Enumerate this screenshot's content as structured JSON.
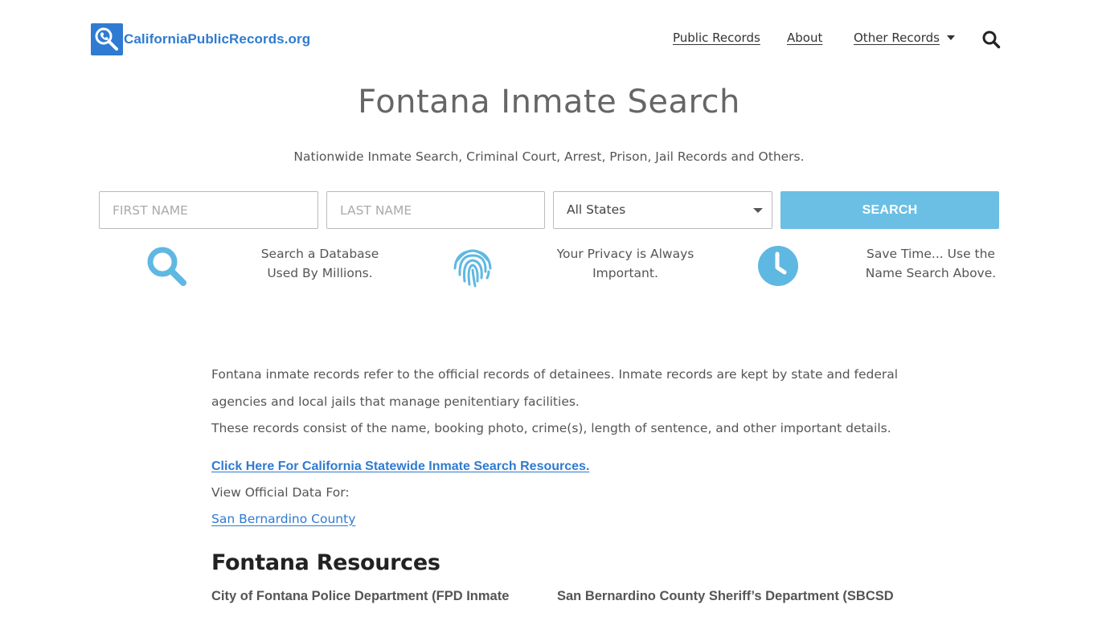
{
  "header": {
    "logo_text": "CaliforniaPublicRecords.org",
    "nav": {
      "public_records": "Public Records",
      "about": "About",
      "other_records": "Other Records"
    },
    "search_icon": "search-icon"
  },
  "hero": {
    "title": "Fontana Inmate Search",
    "subtitle": "Nationwide Inmate Search, Criminal Court, Arrest, Prison, Jail Records and Others."
  },
  "search_form": {
    "first_name_placeholder": "FIRST NAME",
    "last_name_placeholder": "LAST NAME",
    "state_selected": "All States",
    "search_label": "SEARCH"
  },
  "features": [
    {
      "icon": "magnifier-icon",
      "line1": "Search a Database",
      "line2": "Used By Millions."
    },
    {
      "icon": "fingerprint-icon",
      "line1": "Your Privacy is Always",
      "line2": "Important."
    },
    {
      "icon": "clock-icon",
      "line1": "Save Time... Use the",
      "line2": "Name Search Above."
    }
  ],
  "content": {
    "intro_p1": "Fontana inmate records refer to the official records of detainees. Inmate records are kept by state and federal agencies and local jails that manage penitentiary facilities.",
    "intro_p2": "These records consist of the name, booking photo, crime(s), length of sentence, and other important details.",
    "statewide_link": "Click Here For California Statewide Inmate Search Resources.",
    "view_label": "View Official Data For:",
    "county_link": "San Bernardino County",
    "resources_title": "Fontana Resources",
    "resources": [
      "City of Fontana Police Department (FPD Inmate",
      "San Bernardino County Sheriff’s Department (SBCSD"
    ]
  },
  "colors": {
    "brand_blue": "#2f7bd1",
    "accent_light_blue": "#6bbfe4",
    "text_gray": "#555555"
  }
}
